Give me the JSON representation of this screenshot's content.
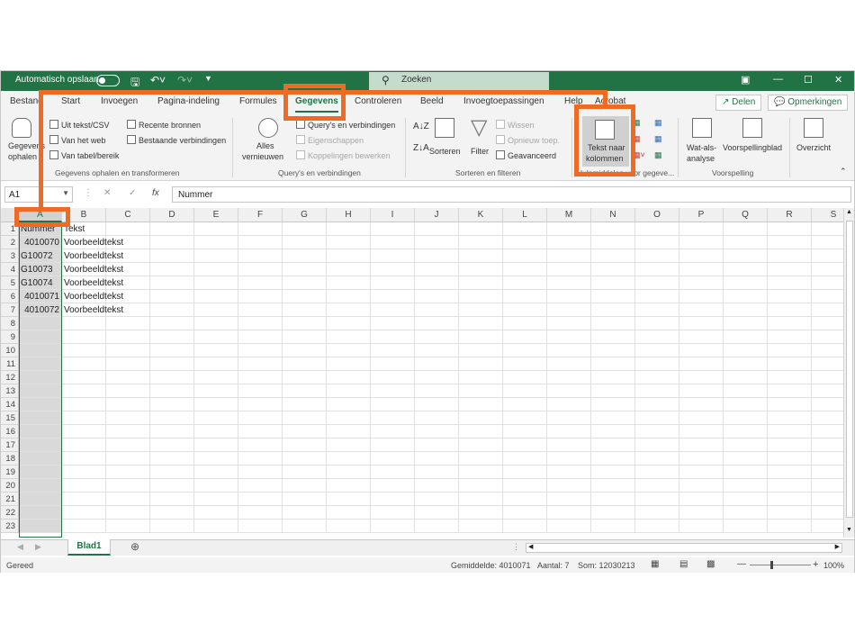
{
  "titlebar": {
    "autosave_label": "Automatisch opslaan",
    "search_placeholder": "Zoeken"
  },
  "tabs": [
    "Bestand",
    "Start",
    "Invoegen",
    "Pagina-indeling",
    "Formules",
    "Gegevens",
    "Controleren",
    "Beeld",
    "Invoegtoepassingen",
    "Help",
    "Acrobat"
  ],
  "share": {
    "share_label": "Delen",
    "comments_label": "Opmerkingen"
  },
  "ribbon": {
    "get_data_label_1": "Gegevens",
    "get_data_label_2": "ophalen",
    "from_text_csv": "Uit tekst/CSV",
    "from_web": "Van het web",
    "from_table": "Van tabel/bereik",
    "recent_sources": "Recente bronnen",
    "existing_connections": "Bestaande verbindingen",
    "group_get_transform": "Gegevens ophalen en transformeren",
    "refresh_all_1": "Alles",
    "refresh_all_2": "vernieuwen",
    "queries_connections": "Query's en verbindingen",
    "properties": "Eigenschappen",
    "edit_links": "Koppelingen bewerken",
    "group_queries": "Query's en verbindingen",
    "sort": "Sorteren",
    "filter": "Filter",
    "clear": "Wissen",
    "reapply": "Opnieuw toep.",
    "advanced": "Geavanceerd",
    "group_sort_filter": "Sorteren en filteren",
    "text_to_columns_1": "Tekst naar",
    "text_to_columns_2": "kolommen",
    "group_data_tools": "Hulpmiddelen voor gegeve...",
    "whatif_1": "Wat-als-",
    "whatif_2": "analyse",
    "forecast_sheet": "Voorspellingblad",
    "group_forecast": "Voorspelling",
    "outline": "Overzicht"
  },
  "formula_bar": {
    "name_box": "A1",
    "fx": "fx",
    "value": "Nummer"
  },
  "columns": [
    "A",
    "B",
    "C",
    "D",
    "E",
    "F",
    "G",
    "H",
    "I",
    "J",
    "K",
    "L",
    "M",
    "N",
    "O",
    "P",
    "Q",
    "R",
    "S"
  ],
  "rows": [
    "1",
    "2",
    "3",
    "4",
    "5",
    "6",
    "7",
    "8",
    "9",
    "10",
    "11",
    "12",
    "13",
    "14",
    "15",
    "16",
    "17",
    "18",
    "19",
    "20",
    "21",
    "22",
    "23"
  ],
  "cells": {
    "A1": "Nummer",
    "B1": "Tekst",
    "A2": "4010070",
    "B2": "Voorbeeldtekst",
    "A3": "G10072",
    "B3": "Voorbeeldtekst",
    "A4": "G10073",
    "B4": "Voorbeeldtekst",
    "A5": "G10074",
    "B5": "Voorbeeldtekst",
    "A6": "4010071",
    "B6": "Voorbeeldtekst",
    "A7": "4010072",
    "B7": "Voorbeeldtekst"
  },
  "sheet": {
    "tab_name": "Blad1"
  },
  "status": {
    "ready": "Gereed",
    "average": "Gemiddelde: 4010071",
    "count": "Aantal: 7",
    "sum": "Som: 12030213",
    "zoom": "100%"
  },
  "colors": {
    "accent": "#217346",
    "highlight": "#f06a23"
  }
}
